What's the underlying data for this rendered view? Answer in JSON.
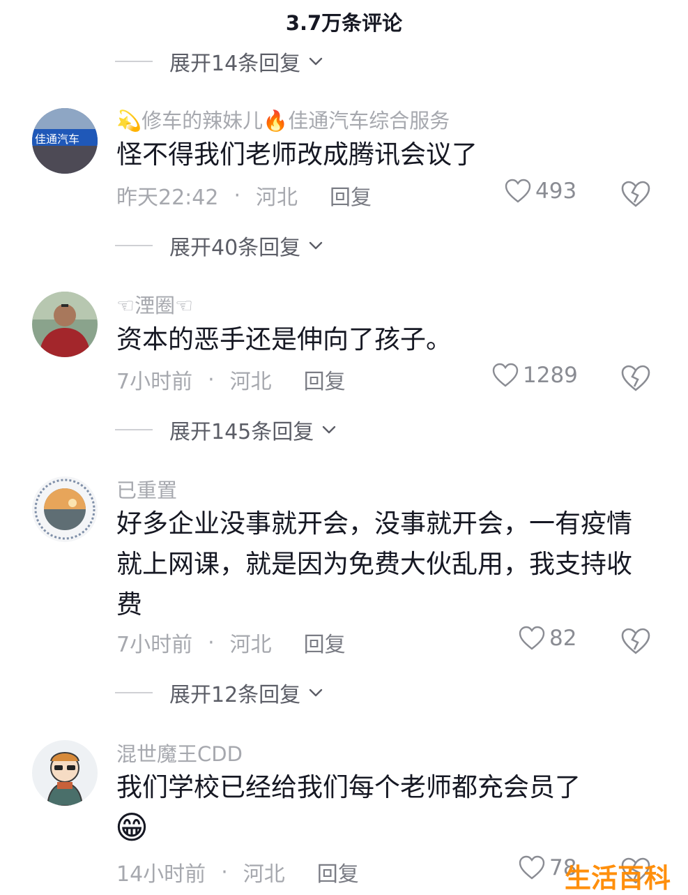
{
  "header": {
    "title": "3.7万条评论"
  },
  "expand_rows": [
    {
      "label": "展开14条回复"
    },
    {
      "label": "展开40条回复"
    },
    {
      "label": "展开145条回复"
    },
    {
      "label": "展开12条回复"
    }
  ],
  "comments": [
    {
      "username": "💫修车的辣妹儿🔥佳通汽车综合服务",
      "avatar_text": "佳通汽车",
      "text": "怪不得我们老师改成腾讯会议了",
      "time": "昨天22:42",
      "location": "河北",
      "reply_label": "回复",
      "likes": "493"
    },
    {
      "username": "☜湮圈☜",
      "text": "资本的恶手还是伸向了孩子。",
      "time": "7小时前",
      "location": "河北",
      "reply_label": "回复",
      "likes": "1289"
    },
    {
      "username": "已重置",
      "text": "好多企业没事就开会，没事就开会，一有疫情就上网课，就是因为免费大伙乱用，我支持收费",
      "time": "7小时前",
      "location": "河北",
      "reply_label": "回复",
      "likes": "82"
    },
    {
      "username": "混世魔王CDD",
      "text": "我们学校已经给我们每个老师都充会员了",
      "emoji": "😁",
      "time": "14小时前",
      "location": "河北",
      "reply_label": "回复",
      "likes": "78"
    }
  ],
  "watermark": {
    "text": "生活百科"
  },
  "icons": {
    "like": "heart-outline-icon",
    "dislike": "broken-heart-icon",
    "expand": "chevron-down-icon"
  }
}
